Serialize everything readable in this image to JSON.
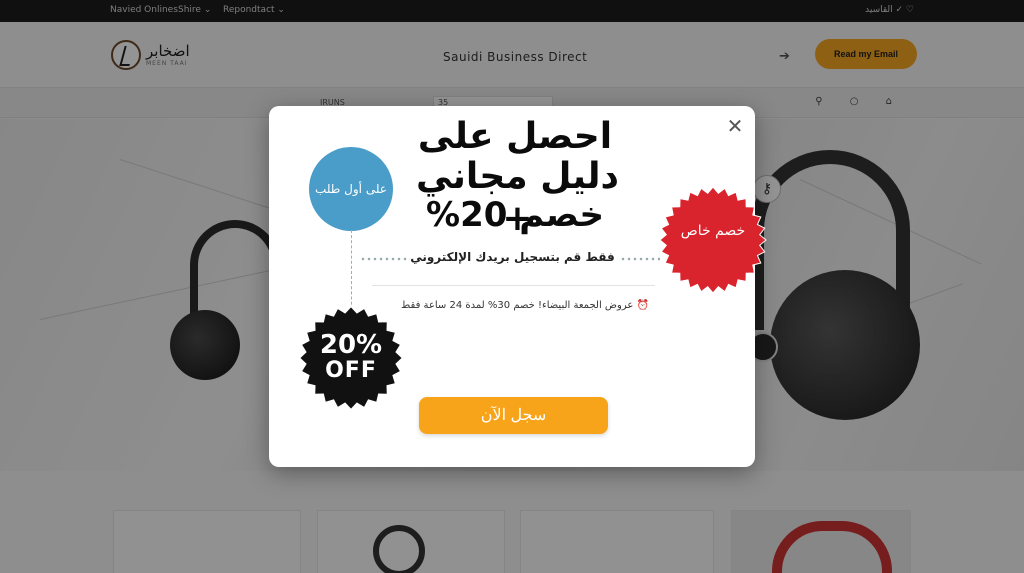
{
  "topbar": {
    "links": [
      "Navied Onlines",
      "Shire ⌄",
      "Repondtact ⌄"
    ],
    "right_text": "القاسيد ✓ ♡"
  },
  "header": {
    "logo_text": "اضخابر",
    "logo_sub": "MEEN TAAI",
    "site_title": "Sauidi Business Direct",
    "cta_label": "Read my Email"
  },
  "nav": {
    "item_a": "IRUNS",
    "search_value": "35",
    "icons": "⚲ ○ ⌂"
  },
  "modal": {
    "headline_line1": "احصل على",
    "headline_line2": "دليل مجاني +",
    "headline_line3": "خصم 20%",
    "badge_first_order": "على أول طلب",
    "badge_special": "خصم خاص",
    "subtitle": "فقط قم بتسجيل بريدك الإلكتروني",
    "promo_text": "عروض الجمعة البيضاء! خصم 30% لمدة 24 ساعة فقط",
    "promo_icon": "⏰",
    "badge_off_line1": "20%",
    "badge_off_line2": "OFF",
    "cta_label": "سجل الآن",
    "close_symbol": "✕"
  },
  "colors": {
    "cta_orange": "#f7a41a",
    "badge_red": "#d9232d",
    "badge_blue": "#4a9cc9",
    "badge_black": "#111111"
  }
}
